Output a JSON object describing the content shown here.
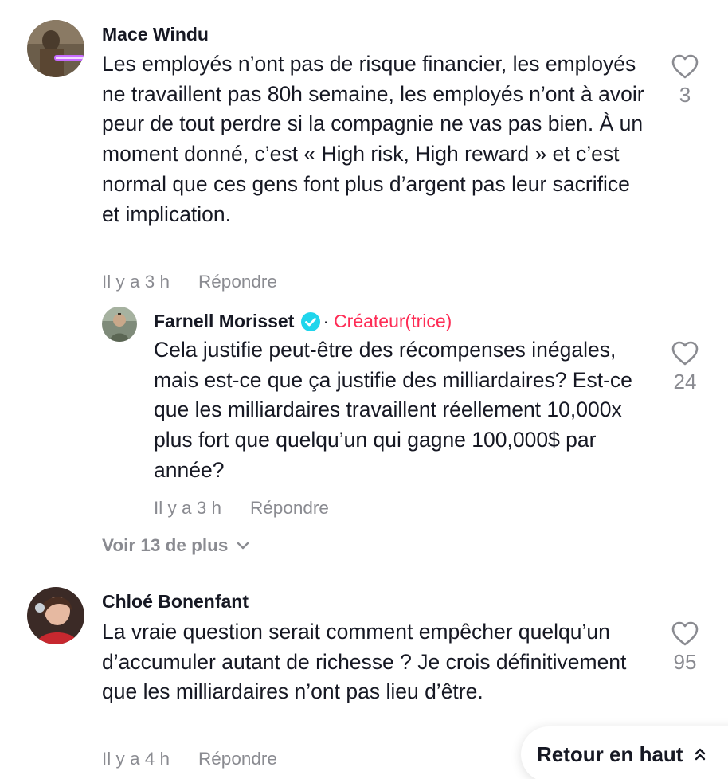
{
  "comments": [
    {
      "username": "Mace Windu",
      "text": "Les employés n’ont pas de risque financier, les employés ne travaillent pas 80h semaine, les employés n’ont à avoir peur de tout perdre si la compagnie ne vas pas bien. À un moment donné, c’est « High risk, High reward » et c’est normal que ces gens font plus d’argent pas leur sacrifice et implication.",
      "time": "Il y a 3 h",
      "reply_label": "Répondre",
      "likes": "3",
      "avatar_icon": "avatar-lightsaber"
    },
    {
      "username": "Chloé Bonenfant",
      "text": "La vraie question serait comment empêcher quelqu’un d’accumuler autant de richesse ? Je crois définitivement que les milliardaires n’ont pas lieu d’être.",
      "time": "Il y a 4 h",
      "reply_label": "Répondre",
      "likes": "95",
      "avatar_icon": "avatar-person"
    }
  ],
  "reply": {
    "username": "Farnell Morisset",
    "separator": "·",
    "creator_label": "Créateur(trice)",
    "text": "Cela justifie peut-être des récompenses inégales, mais est-ce que ça justifie des milliardaires? Est-ce que les milliardaires travaillent réellement 10,000x plus fort que quelqu’un qui gagne 100,000$ par année?",
    "time": "Il y a 3 h",
    "reply_label": "Répondre",
    "likes": "24",
    "verified_icon": "verified-badge-icon"
  },
  "view_more_label": "Voir 13 de plus",
  "back_to_top_label": "Retour en haut",
  "colors": {
    "text": "#161823",
    "muted": "#8a8b91",
    "creator": "#fe2c55",
    "verified": "#20d5ec"
  }
}
